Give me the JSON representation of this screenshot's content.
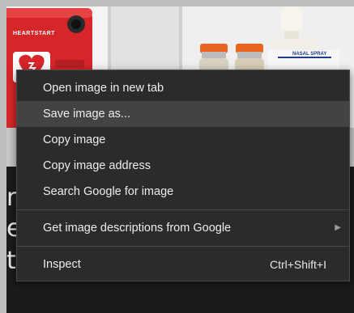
{
  "background": {
    "aed_brand": "HEARTSTART",
    "spray_label": "NASAL SPRAY",
    "side_text": [
      "na",
      "e",
      "t"
    ]
  },
  "colors": {
    "menu_bg": "#2b2b2b",
    "menu_hover": "#434343",
    "menu_text": "#ededed",
    "aed_red": "#d7262a",
    "vial_cap_orange": "#e8651f"
  },
  "context_menu": {
    "items": [
      {
        "label": "Open image in new tab"
      },
      {
        "label": "Save image as..."
      },
      {
        "label": "Copy image"
      },
      {
        "label": "Copy image address"
      },
      {
        "label": "Search Google for image"
      },
      {
        "label": "Get image descriptions from Google"
      },
      {
        "label": "Inspect",
        "shortcut": "Ctrl+Shift+I"
      }
    ],
    "hovered_index": 1,
    "submenu_icon": "chevron-right-icon"
  }
}
